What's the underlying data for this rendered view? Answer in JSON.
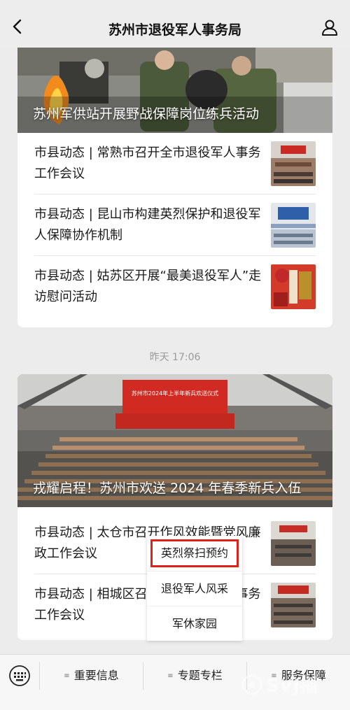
{
  "header": {
    "title": "苏州市退役军人事务局"
  },
  "card1": {
    "hero_caption": "苏州军供站开展野战保障岗位练兵活动",
    "items": [
      {
        "title": "市县动态 | 常熟市召开全市退役军人事务工作会议",
        "thumb_icon": "meeting-photo"
      },
      {
        "title": "市县动态 | 昆山市构建英烈保护和退役军人保障协作机制",
        "thumb_icon": "meeting-photo"
      },
      {
        "title": "市县动态 | 姑苏区开展“最美退役军人”走访慰问活动",
        "thumb_icon": "gift-photo"
      }
    ]
  },
  "timestamp": "昨天 17:06",
  "card2": {
    "hero_caption": "戎耀启程！苏州市欢送 2024 年春季新兵入伍",
    "banner_text": "苏州市2024年上半年新兵欢送仪式",
    "items": [
      {
        "title": "市县动态 | 太仓市召开作风效能暨党风廉政工作会议",
        "thumb_icon": "meeting-photo"
      },
      {
        "title": "市县动态 | 相城区召开全区退役军人事务工作会议",
        "thumb_icon": "meeting-photo"
      }
    ]
  },
  "popup_menu": {
    "items": [
      "英烈祭扫预约",
      "退役军人风采",
      "军休家园"
    ],
    "highlighted_index": 0,
    "highlight_color": "#e0201b"
  },
  "bottom_menu": {
    "tabs": [
      "重要信息",
      "专题专栏",
      "服务保障"
    ]
  },
  "watermark": "SVJ播"
}
